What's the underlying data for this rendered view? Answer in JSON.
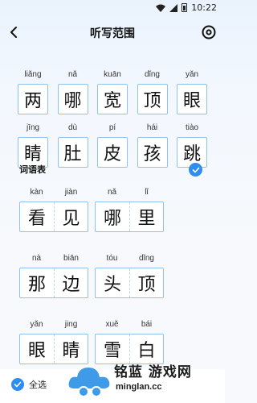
{
  "status": {
    "time": "10:22"
  },
  "header": {
    "title": "听写范围",
    "back_icon": "arrow-left-icon",
    "settings_icon": "gear-icon"
  },
  "characters": [
    [
      {
        "pinyin": "liǎng",
        "char": "两"
      },
      {
        "pinyin": "nǎ",
        "char": "哪"
      },
      {
        "pinyin": "kuān",
        "char": "宽"
      },
      {
        "pinyin": "dǐng",
        "char": "顶"
      },
      {
        "pinyin": "yǎn",
        "char": "眼"
      }
    ],
    [
      {
        "pinyin": "jīng",
        "char": "睛"
      },
      {
        "pinyin": "dù",
        "char": "肚"
      },
      {
        "pinyin": "pí",
        "char": "皮"
      },
      {
        "pinyin": "hái",
        "char": "孩"
      },
      {
        "pinyin": "tiào",
        "char": "跳"
      }
    ]
  ],
  "words_section": {
    "label": "词语表",
    "checked": true,
    "accent": "#2f8cf0"
  },
  "words": [
    [
      {
        "pinyin": [
          "kàn",
          "jiàn"
        ],
        "chars": [
          "看",
          "见"
        ]
      },
      {
        "pinyin": [
          "nǎ",
          "lǐ"
        ],
        "chars": [
          "哪",
          "里"
        ]
      }
    ],
    [
      {
        "pinyin": [
          "nà",
          "biān"
        ],
        "chars": [
          "那",
          "边"
        ]
      },
      {
        "pinyin": [
          "tóu",
          "dǐng"
        ],
        "chars": [
          "头",
          "顶"
        ]
      }
    ],
    [
      {
        "pinyin": [
          "yǎn",
          "jing"
        ],
        "chars": [
          "眼",
          "睛"
        ]
      },
      {
        "pinyin": [
          "xuě",
          "bái"
        ],
        "chars": [
          "雪",
          "白"
        ]
      }
    ]
  ],
  "bottom": {
    "select_all": "全选"
  },
  "watermark": {
    "text": "铭蓝 游戏网",
    "url": "minglan.cc"
  },
  "colors": {
    "box_border": "#8fc2f0",
    "accent": "#2f8cf0"
  }
}
